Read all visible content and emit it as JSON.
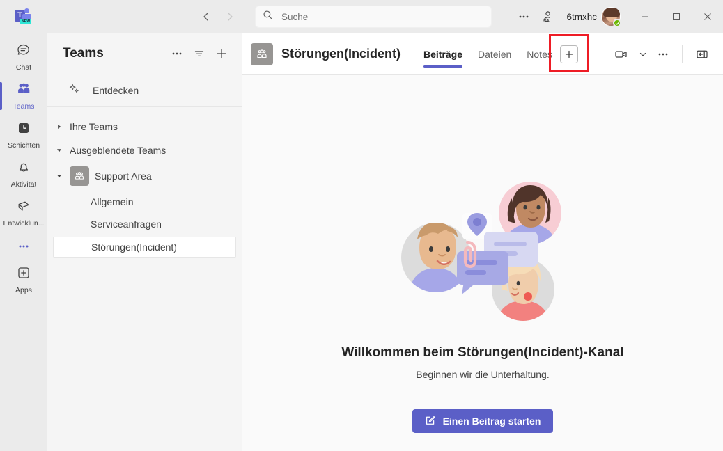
{
  "titlebar": {
    "logo_badge": "NEW",
    "logo_letter": "T",
    "back_label": "Zurück",
    "forward_label": "Vorwärts",
    "search": {
      "placeholder": "Suche",
      "value": ""
    },
    "more_label": "Weitere Optionen",
    "notify_label": "Benachrichtigungen",
    "username": "6tmxhc",
    "presence": "Verfügbar",
    "minimize_label": "Minimieren",
    "maximize_label": "Maximieren",
    "close_label": "Schließen"
  },
  "rail": {
    "items": [
      {
        "label": "Chat",
        "icon": "chat-icon",
        "active": false
      },
      {
        "label": "Teams",
        "icon": "teams-icon",
        "active": true
      },
      {
        "label": "Schichten",
        "icon": "shifts-icon",
        "active": false
      },
      {
        "label": "Aktivität",
        "icon": "bell-icon",
        "active": false
      },
      {
        "label": "Entwicklun...",
        "icon": "developer-icon",
        "active": false
      }
    ],
    "more_label": "Weitere Apps",
    "apps": {
      "label": "Apps",
      "icon": "plus-box-icon"
    }
  },
  "teams_panel": {
    "title": "Teams",
    "more_label": "Weitere Optionen",
    "filter_label": "Filtern",
    "add_label": "Team beitreten oder erstellen",
    "discover": {
      "label": "Entdecken",
      "icon": "sparkle-icon"
    },
    "groups": [
      {
        "label": "Ihre Teams",
        "expanded": false
      },
      {
        "label": "Ausgeblendete Teams",
        "expanded": true
      }
    ],
    "team": {
      "name": "Support Area",
      "expanded": true
    },
    "channels": [
      {
        "label": "Allgemein",
        "selected": false
      },
      {
        "label": "Serviceanfragen",
        "selected": false
      },
      {
        "label": "Störungen(Incident)",
        "selected": true
      }
    ]
  },
  "channel_header": {
    "title": "Störungen(Incident)",
    "tabs": [
      {
        "label": "Beiträge",
        "active": true
      },
      {
        "label": "Dateien",
        "active": false
      },
      {
        "label": "Notes",
        "active": false
      }
    ],
    "add_tab_label": "+",
    "add_tab_name": "Registerkarte hinzufügen",
    "meet_label": "Besprechung",
    "meet_chevron": "Besprechungsoptionen",
    "more_label": "Weitere Optionen",
    "collapse_label": "Bereich öffnen",
    "highlight_color": "#ee1c25"
  },
  "welcome": {
    "title": "Willkommen beim Störungen(Incident)-Kanal",
    "subtitle": "Beginnen wir die Unterhaltung.",
    "start_button": "Einen Beitrag starten",
    "start_button_icon": "compose-icon",
    "accent_color": "#5b5fc7"
  }
}
